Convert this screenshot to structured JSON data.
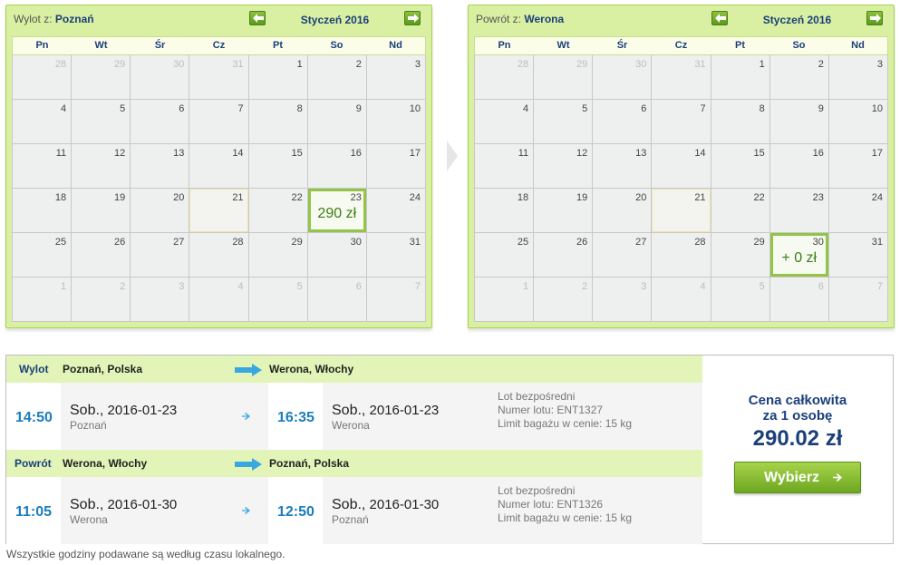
{
  "outbound_calendar": {
    "label": "Wylot z:",
    "city": "Poznań",
    "month": "Styczeń 2016",
    "weekdays": [
      "Pn",
      "Wt",
      "Śr",
      "Cz",
      "Pt",
      "So",
      "Nd"
    ],
    "weeks": [
      [
        "28",
        "29",
        "30",
        "31",
        "1",
        "2",
        "3"
      ],
      [
        "4",
        "5",
        "6",
        "7",
        "8",
        "9",
        "10"
      ],
      [
        "11",
        "12",
        "13",
        "14",
        "15",
        "16",
        "17"
      ],
      [
        "18",
        "19",
        "20",
        "21",
        "22",
        "23",
        "24"
      ],
      [
        "25",
        "26",
        "27",
        "28",
        "29",
        "30",
        "31"
      ],
      [
        "1",
        "2",
        "3",
        "4",
        "5",
        "6",
        "7"
      ]
    ],
    "selected_price": "290 zł"
  },
  "return_calendar": {
    "label": "Powrót z:",
    "city": "Werona",
    "month": "Styczeń 2016",
    "weekdays": [
      "Pn",
      "Wt",
      "Śr",
      "Cz",
      "Pt",
      "So",
      "Nd"
    ],
    "weeks": [
      [
        "28",
        "29",
        "30",
        "31",
        "1",
        "2",
        "3"
      ],
      [
        "4",
        "5",
        "6",
        "7",
        "8",
        "9",
        "10"
      ],
      [
        "11",
        "12",
        "13",
        "14",
        "15",
        "16",
        "17"
      ],
      [
        "18",
        "19",
        "20",
        "21",
        "22",
        "23",
        "24"
      ],
      [
        "25",
        "26",
        "27",
        "28",
        "29",
        "30",
        "31"
      ],
      [
        "1",
        "2",
        "3",
        "4",
        "5",
        "6",
        "7"
      ]
    ],
    "selected_price": "+ 0 zł"
  },
  "flights": [
    {
      "tag": "Wylot",
      "from": "Poznań, Polska",
      "to": "Werona, Włochy",
      "dep_time": "14:50",
      "dep_day": "Sob.,",
      "dep_date": "2016-01-23",
      "dep_city": "Poznań",
      "arr_time": "16:35",
      "arr_day": "Sob.,",
      "arr_date": "2016-01-23",
      "arr_city": "Werona",
      "detail_1": "Lot bezpośredni",
      "detail_2": "Numer lotu: ENT1327",
      "detail_3": "Limit bagażu w cenie: 15 kg"
    },
    {
      "tag": "Powrót",
      "from": "Werona, Włochy",
      "to": "Poznań, Polska",
      "dep_time": "11:05",
      "dep_day": "Sob.,",
      "dep_date": "2016-01-30",
      "dep_city": "Werona",
      "arr_time": "12:50",
      "arr_day": "Sob.,",
      "arr_date": "2016-01-30",
      "arr_city": "Poznań",
      "detail_1": "Lot bezpośredni",
      "detail_2": "Numer lotu: ENT1326",
      "detail_3": "Limit bagażu w cenie: 15 kg"
    }
  ],
  "summary": {
    "total_label_1": "Cena całkowita",
    "total_label_2": "za 1 osobę",
    "total_price": "290.02 zł",
    "choose_label": "Wybierz"
  },
  "footnote": "Wszystkie godziny podawane są według czasu lokalnego.",
  "colors": {
    "accent_green": "#93c447",
    "navy": "#1b3f7a",
    "time_blue": "#1a7dbd",
    "arrow_blue": "#3aa7e0"
  }
}
